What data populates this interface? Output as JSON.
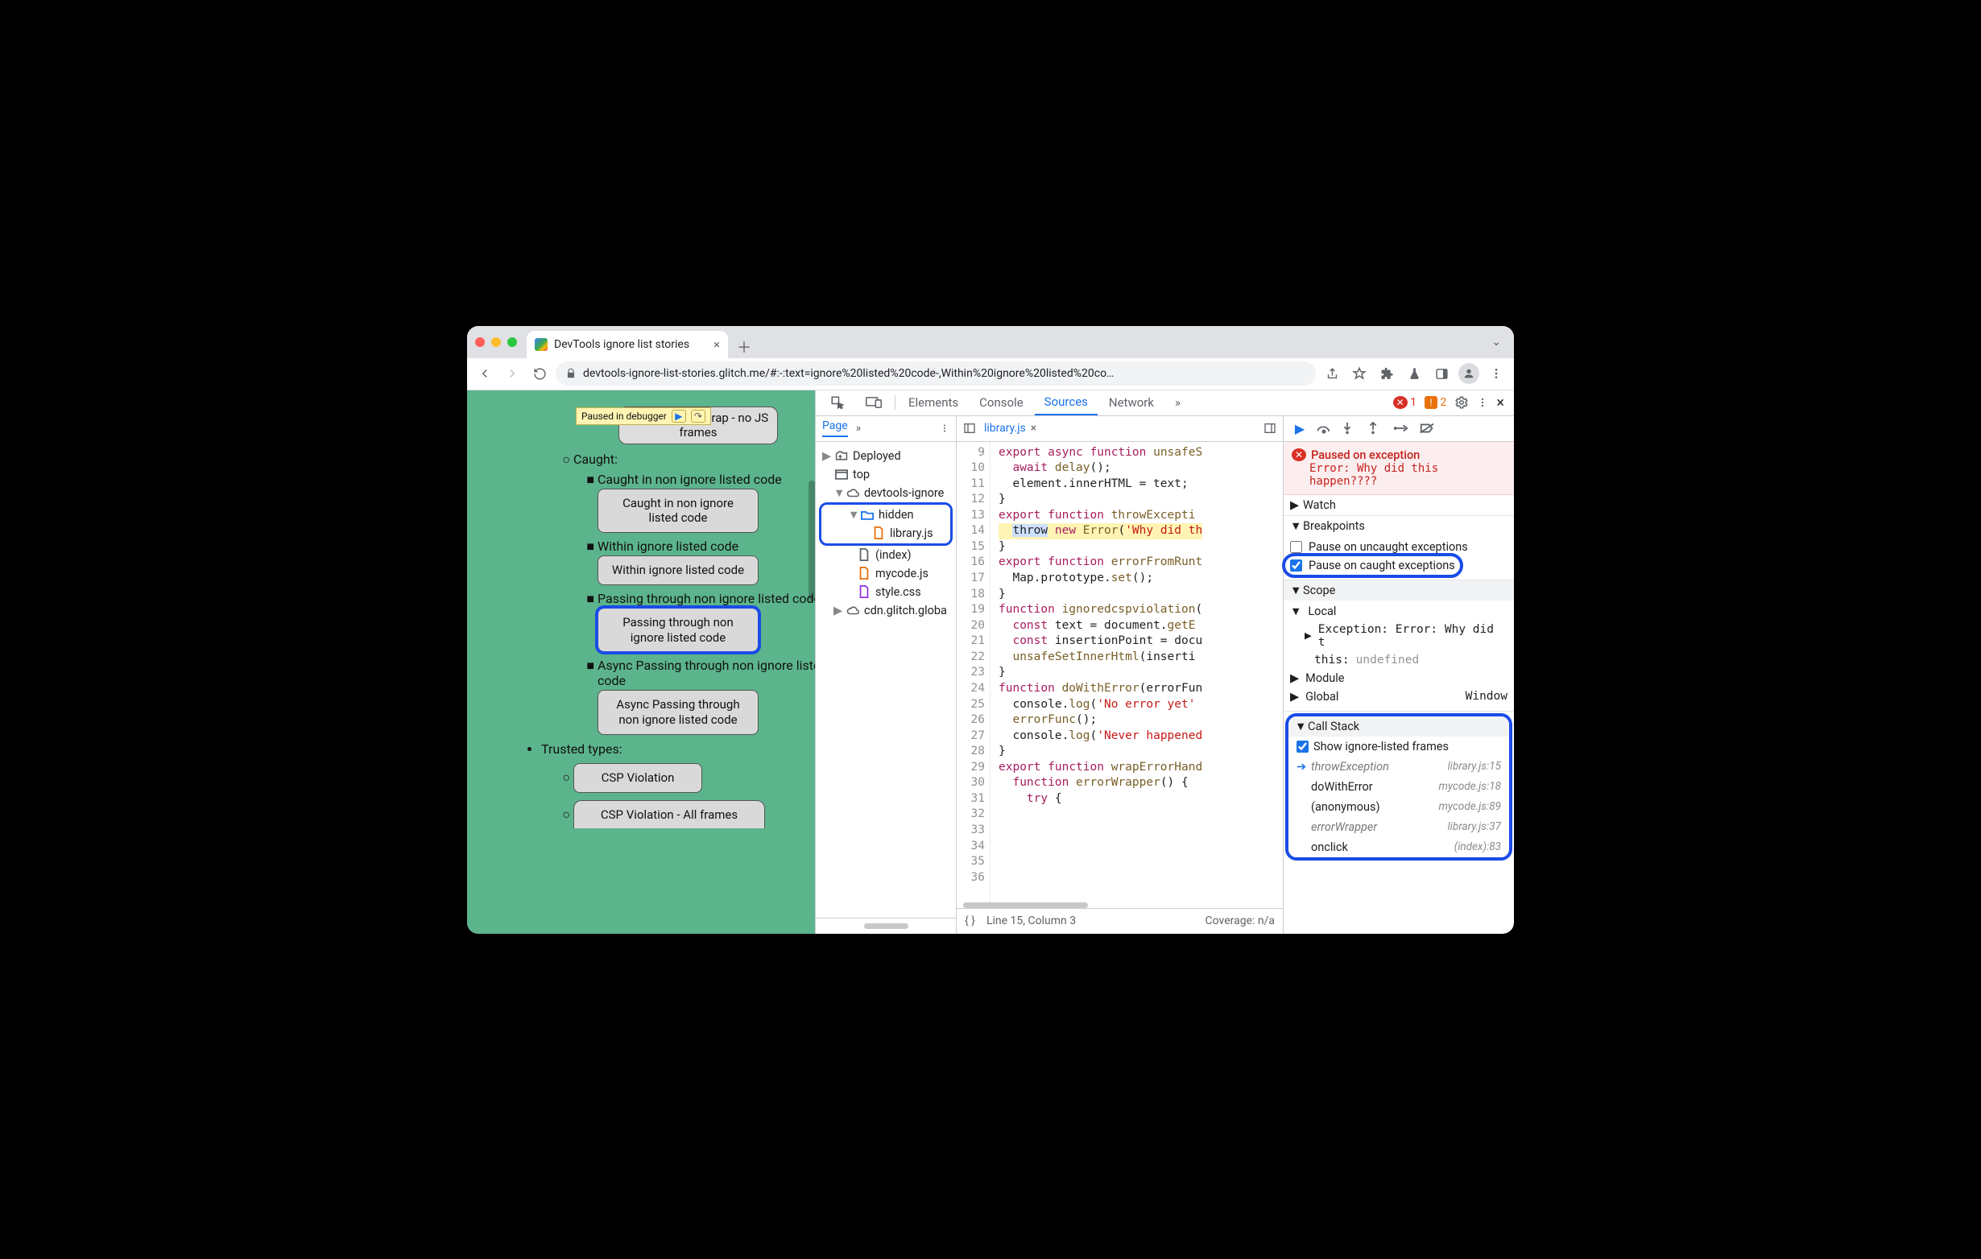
{
  "window": {
    "tab_title": "DevTools ignore list stories",
    "url_display": "devtools-ignore-list-stories.glitch.me/#:-:text=ignore%20listed%20code-,Within%20ignore%20listed%20co…"
  },
  "debug_badge": {
    "label": "Paused in debugger"
  },
  "page": {
    "top_button": "WebAssembly trap - no JS frames",
    "caught_label": "Caught:",
    "items": [
      {
        "label": "Caught in non ignore listed code",
        "button": "Caught in non ignore listed code"
      },
      {
        "label": "Within ignore listed code",
        "button": "Within ignore listed code"
      },
      {
        "label": "Passing through non ignore listed code",
        "button": "Passing through non ignore listed code",
        "highlight": true
      },
      {
        "label": "Async Passing through non ignore listed code",
        "button": "Async Passing through non ignore listed code"
      }
    ],
    "trusted_label": "Trusted types:",
    "trusted_buttons": [
      "CSP Violation",
      "CSP Violation - All frames"
    ]
  },
  "devtools": {
    "tabs": [
      "Elements",
      "Console",
      "Sources",
      "Network"
    ],
    "active_tab": "Sources",
    "errors": 1,
    "warnings": 2,
    "nav": {
      "page_label": "Page",
      "tree": [
        {
          "icon": "deploy",
          "label": "Deployed",
          "depth": 0,
          "arrow": "▶"
        },
        {
          "icon": "frame",
          "label": "top",
          "depth": 0,
          "arrow": ""
        },
        {
          "icon": "cloud",
          "label": "devtools-ignore",
          "depth": 1,
          "arrow": "▼"
        },
        {
          "icon": "folder",
          "label": "hidden",
          "depth": 2,
          "arrow": "▼",
          "hlStart": true
        },
        {
          "icon": "file-js",
          "label": "library.js",
          "depth": 3,
          "arrow": "",
          "hlEnd": true
        },
        {
          "icon": "file-html",
          "label": "(index)",
          "depth": 2,
          "arrow": ""
        },
        {
          "icon": "file-js",
          "label": "mycode.js",
          "depth": 2,
          "arrow": ""
        },
        {
          "icon": "file-css",
          "label": "style.css",
          "depth": 2,
          "arrow": ""
        },
        {
          "icon": "cloud",
          "label": "cdn.glitch.globa",
          "depth": 1,
          "arrow": "▶"
        }
      ]
    },
    "editor": {
      "filename": "library.js",
      "first_line": 9,
      "lines": [
        {
          "html": "<span class='kw'>export</span> <span class='kw'>async</span> <span class='kw'>function</span> <span class='fn'>unsafeS</span>"
        },
        {
          "html": "  <span class='kw'>await</span> <span class='fn'>delay</span>();"
        },
        {
          "html": "  element.innerHTML = text;"
        },
        {
          "html": "}"
        },
        {
          "html": ""
        },
        {
          "html": "<span class='kw'>export</span> <span class='kw'>function</span> <span class='fn'>throwExcepti</span>"
        },
        {
          "hl": true,
          "html": "  <span class='sel'>throw</span> <span class='kw'>new</span> <span class='fn'>Error</span>(<span class='str'>'Why did th</span>"
        },
        {
          "html": "}"
        },
        {
          "html": ""
        },
        {
          "html": "<span class='kw'>export</span> <span class='kw'>function</span> <span class='fn'>errorFromRunt</span>"
        },
        {
          "html": "  Map.prototype.<span class='fn'>set</span>();"
        },
        {
          "html": "}"
        },
        {
          "html": ""
        },
        {
          "html": "<span class='kw'>function</span> <span class='fn'>ignoredcspviolation</span>("
        },
        {
          "html": "  <span class='kw'>const</span> text = document.<span class='fn'>getE</span>"
        },
        {
          "html": "  <span class='kw'>const</span> insertionPoint = docu"
        },
        {
          "html": "  <span class='fn'>unsafeSetInnerHtml</span>(inserti"
        },
        {
          "html": "}"
        },
        {
          "html": ""
        },
        {
          "html": "<span class='kw'>function</span> <span class='fn'>doWithError</span>(errorFun"
        },
        {
          "html": "  console.<span class='fn'>log</span>(<span class='str'>'No error yet'</span>"
        },
        {
          "html": "  <span class='fn'>errorFunc</span>();"
        },
        {
          "html": "  console.<span class='fn'>log</span>(<span class='str'>'Never happened</span>"
        },
        {
          "html": "}"
        },
        {
          "html": ""
        },
        {
          "html": "<span class='kw'>export</span> <span class='kw'>function</span> <span class='fn'>wrapErrorHand</span>"
        },
        {
          "html": "  <span class='kw'>function</span> <span class='fn'>errorWrapper</span>() {"
        },
        {
          "html": "    <span class='kw'>try</span> {"
        }
      ],
      "status_lc": "Line 15, Column 3",
      "status_cov": "Coverage: n/a"
    },
    "right": {
      "paused_title": "Paused on exception",
      "paused_msg": "Error: Why did this happen????",
      "watch": "Watch",
      "breakpoints": "Breakpoints",
      "bp_uncaught": "Pause on uncaught exceptions",
      "bp_caught": "Pause on caught exceptions",
      "scope": "Scope",
      "scope_local": "Local",
      "scope_ex": "Exception: Error: Why did t",
      "scope_this": "this: ",
      "scope_this_val": "undefined",
      "scope_module": "Module",
      "scope_global": "Global",
      "scope_global_val": "Window",
      "callstack": "Call Stack",
      "show_ignored": "Show ignore-listed frames",
      "frames": [
        {
          "name": "throwException",
          "loc": "library.js:15",
          "ignored": true,
          "current": true
        },
        {
          "name": "doWithError",
          "loc": "mycode.js:18"
        },
        {
          "name": "(anonymous)",
          "loc": "mycode.js:89"
        },
        {
          "name": "errorWrapper",
          "loc": "library.js:37",
          "ignored": true
        },
        {
          "name": "onclick",
          "loc": "(index):83"
        }
      ]
    }
  }
}
